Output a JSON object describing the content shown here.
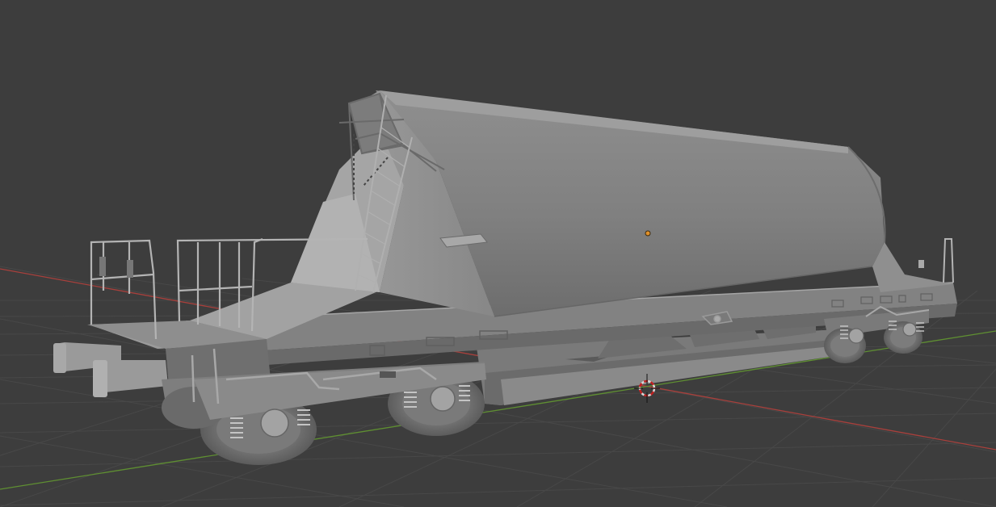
{
  "viewport": {
    "background": "#3d3d3d",
    "grid_color": "#4a4a4a",
    "x_axis_color": "#b0423e",
    "y_axis_color": "#6a9a3a",
    "model_color": "#8a8a8a",
    "origin_dot_color": "#e0902a",
    "cursor_color": "#c02020"
  },
  "icons": {
    "cursor": "3d-cursor-icon",
    "origin": "object-origin-icon"
  }
}
